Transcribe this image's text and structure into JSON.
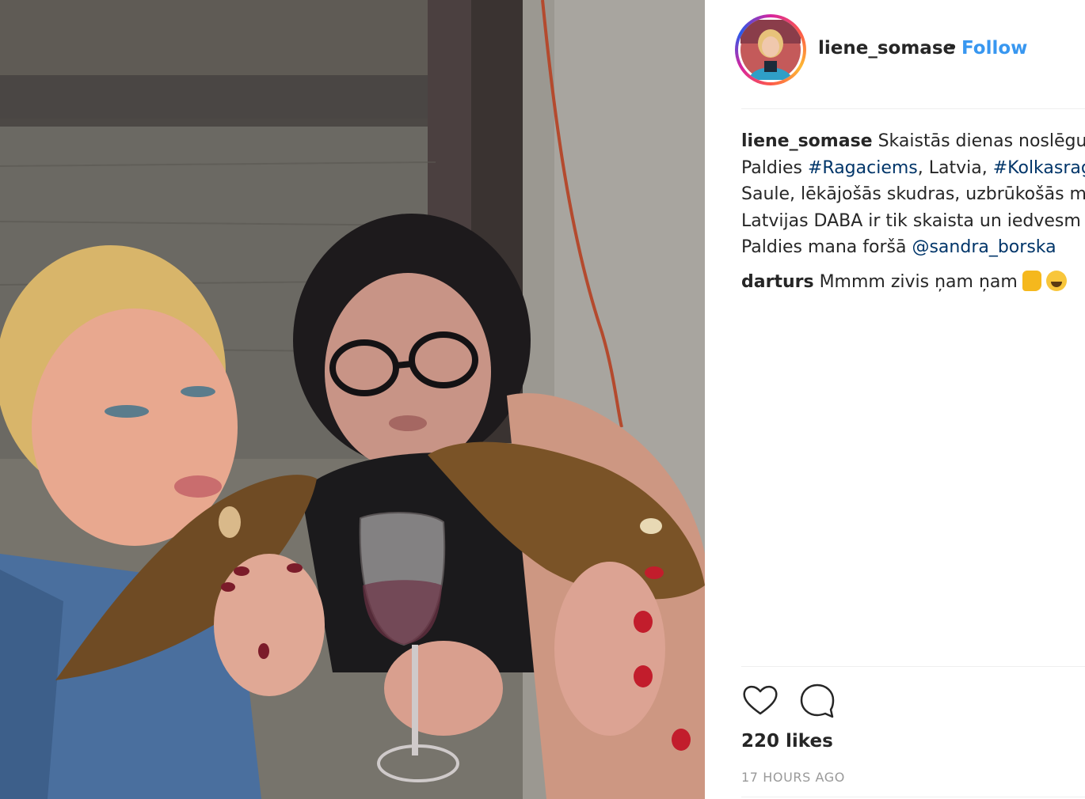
{
  "post": {
    "photo_alt": "",
    "author": {
      "username": "liene_somase",
      "separator": "•",
      "follow_label": "Follow"
    },
    "caption": {
      "username": "liene_somase",
      "line1_text": "Skaistās dienas noslēgu",
      "line2_prefix": "Paldies ",
      "line2_tag1": "#Ragaciems",
      "line2_mid": ", Latvia, ",
      "line2_tag2": "#Kolkasrag",
      "line3": "Saule, lēkājošās skudras, uzbrūkošās m",
      "line4": "Latvijas DABA ir tik skaista un iedvesm",
      "line5_prefix": "Paldies mana foršā ",
      "line5_mention": "@sandra_borska"
    },
    "comments": [
      {
        "username": "darturs",
        "text": "Mmmm zivis ņam ņam",
        "emojis": [
          "thumbs-up-emoji",
          "laughing-emoji"
        ]
      }
    ],
    "actions": {
      "like_icon": "heart-icon",
      "comment_icon": "comment-icon"
    },
    "likes": "220 likes",
    "timestamp": "17 HOURS AGO"
  },
  "colors": {
    "link": "#003569",
    "follow": "#3897f0",
    "text": "#262626",
    "muted": "#999999"
  }
}
